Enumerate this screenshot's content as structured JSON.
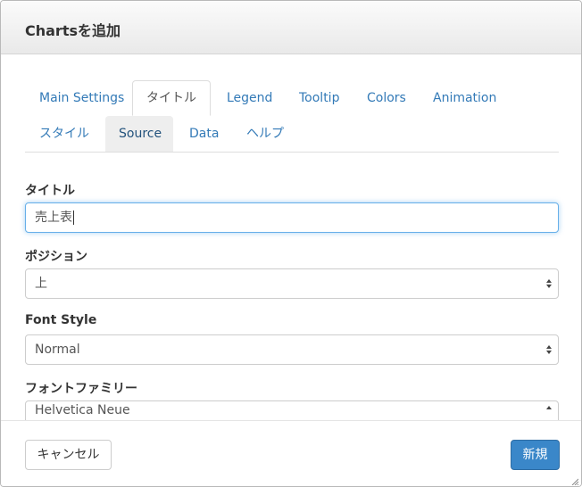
{
  "dialog": {
    "title": "Chartsを追加"
  },
  "tabs": [
    {
      "label": "Main Settings"
    },
    {
      "label": "タイトル"
    },
    {
      "label": "Legend"
    },
    {
      "label": "Tooltip"
    },
    {
      "label": "Colors"
    },
    {
      "label": "Animation"
    },
    {
      "label": "スタイル"
    },
    {
      "label": "Source"
    },
    {
      "label": "Data"
    },
    {
      "label": "ヘルプ"
    }
  ],
  "active_tab": "タイトル",
  "form": {
    "title_label": "タイトル",
    "title_value": "売上表",
    "position_label": "ポジション",
    "position_value": "上",
    "font_style_label": "Font Style",
    "font_style_value": "Normal",
    "font_family_label": "フォントファミリー",
    "font_family_value": "Helvetica Neue"
  },
  "footer": {
    "cancel_label": "キャンセル",
    "new_label": "新規"
  },
  "colors": {
    "link": "#337ab7",
    "primary": "#3a87c9",
    "focus": "#66afe9"
  },
  "icons": [
    "select-arrows-icon",
    "resize-grip-icon"
  ]
}
